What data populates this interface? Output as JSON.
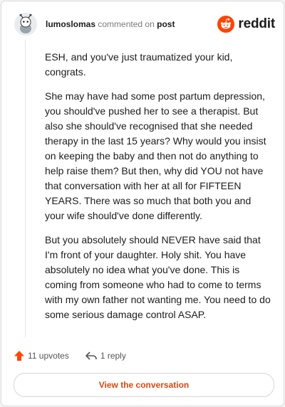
{
  "header": {
    "username": "lumoslomas",
    "action_text": "commented on",
    "link_text": "post",
    "brand": "reddit"
  },
  "comment": {
    "paragraphs": [
      "ESH, and you've just traumatized your kid, congrats.",
      "She may have had some post partum depression, you should've pushed her to see a therapist. But also she should've recognised that she needed therapy in the last 15 years? Why would you insist on keeping the baby and then not do anything to help raise them? But then, why did YOU not have that conversation with her at all for FIFTEEN YEARS. There was so much that both you and your wife should've done differently.",
      "But you absolutely should NEVER have said that I'm front of your daughter. Holy shit. You have absolutely no idea what you've done. This is coming from someone who had to come to terms with my own father not wanting me. You need to do some serious damage control ASAP."
    ]
  },
  "actions": {
    "upvotes": "11 upvotes",
    "replies": "1 reply"
  },
  "cta": {
    "label": "View the conversation"
  },
  "colors": {
    "accent": "#ff4500",
    "cta_text": "#d9480f"
  }
}
